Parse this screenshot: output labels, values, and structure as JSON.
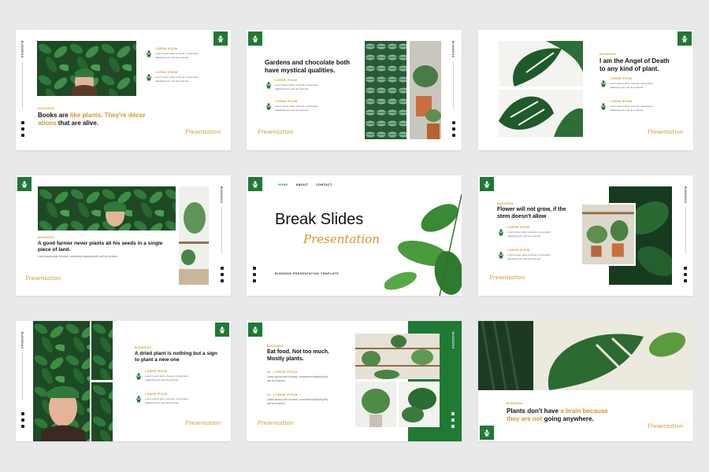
{
  "brand": "BUDDENS",
  "presentation_script": "Presentation",
  "lorem_label": "LOREM IPSUM",
  "lorem_desc": "Lorem ipsum dolor sit amet, consectetur adipiscing elit, sed do eiusmod",
  "slide1": {
    "brand_label": "BUDDENS",
    "heading_part1": "Books are ",
    "heading_part2": "like plants. They're décor",
    "heading_part3": "ations",
    "heading_part4": " that are alive."
  },
  "slide2": {
    "heading": "Gardens and chocolate both have mystical qualities."
  },
  "slide3": {
    "brand_label": "BUDDENS",
    "heading": "I am the Angel of Death to any kind of plant."
  },
  "slide4": {
    "brand_label": "BUDDENS",
    "heading": "A good farmer never plants all his seeds in a single piece of land."
  },
  "slide5": {
    "nav": [
      "HOME",
      "ABOUT",
      "CONTACT"
    ],
    "title": "Break Slides",
    "subtitle": "Presentation",
    "tagline": "BUDDENS PRESENTATION TEMPLATE"
  },
  "slide6": {
    "brand_label": "BUDDENS",
    "heading": "Flower will not grow, if the stem doesn't allow"
  },
  "slide7": {
    "brand_label": "BUDDENS",
    "heading": "A dried plant is nothing but a sign to plant a new one"
  },
  "slide8": {
    "brand_label": "BUDDENS",
    "heading": "Eat food. Not too much. Mostly plants.",
    "item1": "01. LOREM IPSUM",
    "item2": "02. LOREM IPSUM"
  },
  "slide9": {
    "brand_label": "BUDDENS",
    "heading_part1": "Plants don't have ",
    "heading_part2": "a brain because",
    "heading_part3": "they are not",
    "heading_part4": " going anywhere."
  },
  "colors": {
    "green": "#1f7a33",
    "orange": "#d4952a",
    "background": "#e9e9e9"
  },
  "icons": [
    "plant-pot-icon",
    "social-icon"
  ]
}
